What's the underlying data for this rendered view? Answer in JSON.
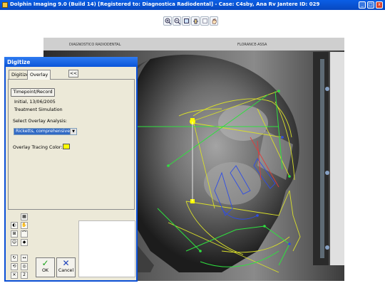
{
  "window": {
    "title": "Dolphin Imaging 9.0 (Build 14) [Registered to: Diagnostica Radiodental] - Case: C4sby, Ana Rv  Jantere ID: 029"
  },
  "toolbar": {
    "icons": [
      "zoom-in-icon",
      "zoom-out-icon",
      "fit-icon",
      "hand-icon",
      "pan-icon",
      "rotate-icon"
    ]
  },
  "dialog": {
    "title": "Digitize",
    "tabs": [
      "Digitize",
      "Overlay"
    ],
    "active_tab": "Overlay",
    "collapse_label": "<<",
    "timepoint_button": "Timepoint/Record",
    "timepoint_line1": "Initial, 13/06/2005",
    "timepoint_line2": "Treatment Simulation",
    "select_label": "Select Overlay Analysis:",
    "analysis_value": "Ricketts, comprehensive",
    "color_label": "Overlay Tracing Color:",
    "color_value": "#ffff00",
    "ok_label": "OK",
    "cancel_label": "Cancel",
    "counter": "2"
  },
  "xray": {
    "header_left": "DIAGNOSTICO RADIODENTAL",
    "header_right": "FLORANCE-ASSA"
  }
}
